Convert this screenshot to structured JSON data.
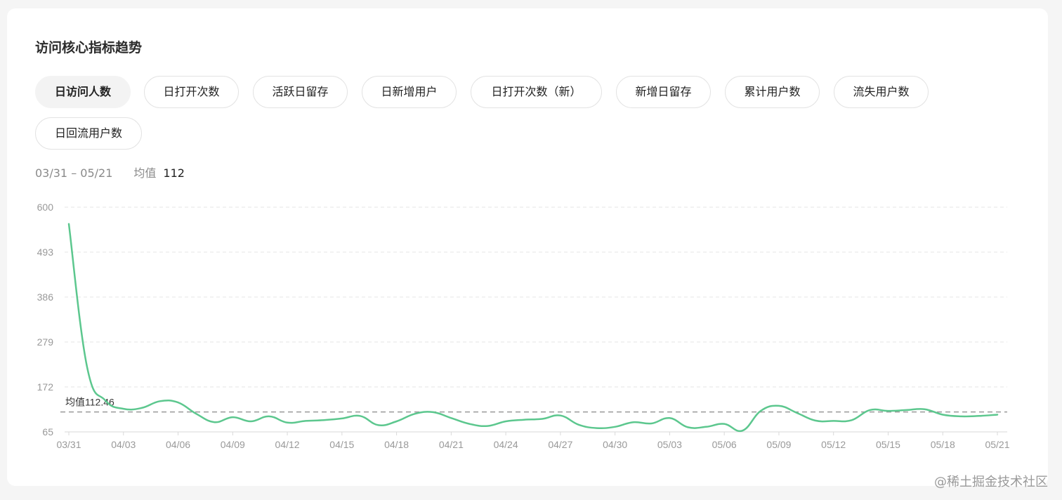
{
  "panel": {
    "title": "访问核心指标趋势",
    "tabs": [
      {
        "label": "日访问人数",
        "active": true
      },
      {
        "label": "日打开次数",
        "active": false
      },
      {
        "label": "活跃日留存",
        "active": false
      },
      {
        "label": "日新增用户",
        "active": false
      },
      {
        "label": "日打开次数（新）",
        "active": false
      },
      {
        "label": "新增日留存",
        "active": false
      },
      {
        "label": "累计用户数",
        "active": false
      },
      {
        "label": "流失用户数",
        "active": false
      },
      {
        "label": "日回流用户数",
        "active": false
      }
    ],
    "date_range": "03/31 – 05/21",
    "avg_label": "均值",
    "avg_value": "112"
  },
  "chart_data": {
    "type": "line",
    "title": "",
    "xlabel": "",
    "ylabel": "",
    "ylim": [
      65,
      600
    ],
    "yticks": [
      "65",
      "172",
      "279",
      "386",
      "493",
      "600"
    ],
    "xticks": [
      "03/31",
      "04/03",
      "04/06",
      "04/09",
      "04/12",
      "04/15",
      "04/18",
      "04/21",
      "04/24",
      "04/27",
      "04/30",
      "05/03",
      "05/06",
      "05/09",
      "05/12",
      "05/15",
      "05/18",
      "05/21"
    ],
    "grid": "horizontal dashed",
    "line_color": "#5cc78e",
    "average": {
      "label": "均值112.46",
      "value": 112.46,
      "color": "#999999"
    },
    "series": [
      {
        "x": [
          "03/31",
          "04/01",
          "04/02",
          "04/03",
          "04/04",
          "04/05",
          "04/06",
          "04/07",
          "04/08",
          "04/09",
          "04/10",
          "04/11",
          "04/12",
          "04/13",
          "04/14",
          "04/15",
          "04/16",
          "04/17",
          "04/18",
          "04/19",
          "04/20",
          "04/21",
          "04/22",
          "04/23",
          "04/24",
          "04/25",
          "04/26",
          "04/27",
          "04/28",
          "04/29",
          "04/30",
          "05/01",
          "05/02",
          "05/03",
          "05/04",
          "05/05",
          "05/06",
          "05/07",
          "05/08",
          "05/09",
          "05/10",
          "05/11",
          "05/12",
          "05/13",
          "05/14",
          "05/15",
          "05/16",
          "05/17",
          "05/18",
          "05/19",
          "05/20",
          "05/21"
        ],
        "values": [
          560,
          220,
          140,
          120,
          122,
          138,
          135,
          108,
          88,
          100,
          90,
          102,
          87,
          91,
          93,
          97,
          103,
          81,
          90,
          108,
          112,
          98,
          84,
          79,
          90,
          94,
          96,
          104,
          82,
          74,
          77,
          88,
          85,
          98,
          76,
          77,
          84,
          68,
          115,
          127,
          110,
          92,
          91,
          93,
          117,
          115,
          117,
          119,
          106,
          102,
          103,
          106
        ]
      }
    ]
  },
  "watermark": "@稀土掘金技术社区"
}
